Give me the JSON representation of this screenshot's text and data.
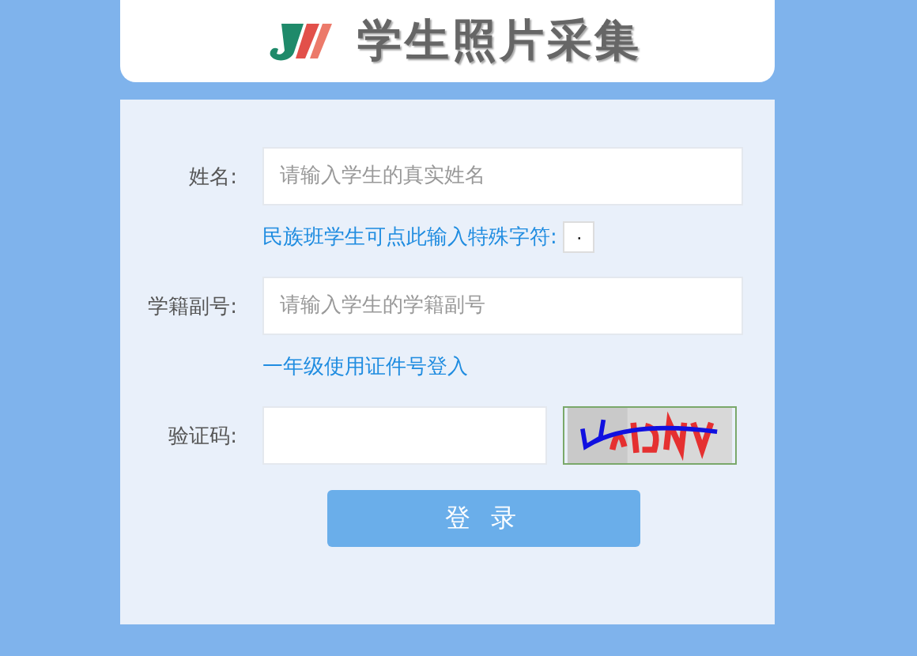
{
  "header": {
    "title": "学生照片采集"
  },
  "form": {
    "fields": [
      {
        "kind": "text",
        "label": "姓名:",
        "placeholder": "请输入学生的真实姓名",
        "note": {
          "text": "民族班学生可点此输入特殊字符:",
          "button": "·"
        }
      },
      {
        "kind": "text",
        "label": "学籍副号:",
        "placeholder": "请输入学生的学籍副号",
        "note": {
          "text": "一年级使用证件号登入"
        }
      },
      {
        "kind": "captcha",
        "label": "验证码:"
      }
    ],
    "submit": "登 录"
  }
}
